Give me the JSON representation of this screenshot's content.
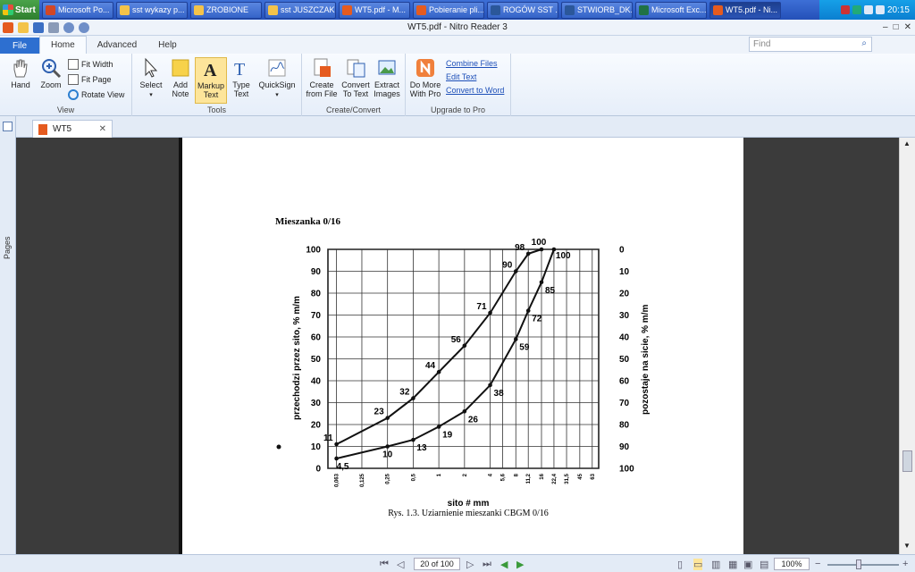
{
  "taskbar": {
    "start_label": "Start",
    "tasks": [
      {
        "label": "Microsoft Po...",
        "color": "#d24726"
      },
      {
        "label": "sst wykazy p...",
        "color": "#f3c34a"
      },
      {
        "label": "ZROBIONE",
        "color": "#f3c34a"
      },
      {
        "label": "sst JUSZCZAK",
        "color": "#f3c34a"
      },
      {
        "label": "WT5.pdf - M...",
        "color": "#e55b1f"
      },
      {
        "label": "Pobieranie pli...",
        "color": "#e55b1f"
      },
      {
        "label": "ROGÓW SST ...",
        "color": "#2b579a"
      },
      {
        "label": "STWIORB_DK...",
        "color": "#2b579a"
      },
      {
        "label": "Microsoft Exc...",
        "color": "#207245"
      },
      {
        "label": "WT5.pdf - Ni...",
        "color": "#e55b1f"
      }
    ],
    "clock": "20:15"
  },
  "window": {
    "title": "WT5.pdf - Nitro Reader 3"
  },
  "ribbon_tabs": [
    "File",
    "Home",
    "Advanced",
    "Help"
  ],
  "search": {
    "placeholder": "Find"
  },
  "ribbon": {
    "view": {
      "label": "View",
      "hand": "Hand",
      "zoom": "Zoom",
      "fit_width": "Fit Width",
      "fit_page": "Fit Page",
      "rotate": "Rotate View"
    },
    "tools": {
      "label": "Tools",
      "select": "Select",
      "add_note_1": "Add",
      "add_note_2": "Note",
      "markup_1": "Markup",
      "markup_2": "Text",
      "type_1": "Type",
      "type_2": "Text",
      "quicksign": "QuickSign"
    },
    "create": {
      "label": "Create/Convert",
      "create_1": "Create",
      "create_2": "from File",
      "convert_1": "Convert",
      "convert_2": "To Text",
      "extract_1": "Extract",
      "extract_2": "Images"
    },
    "upgrade": {
      "label": "Upgrade to Pro",
      "domore_1": "Do More",
      "domore_2": "With Pro",
      "combine": "Combine Files",
      "edit": "Edit Text",
      "convert_word": "Convert to Word"
    }
  },
  "sidepanel": {
    "pages_label": "Pages"
  },
  "doc_tab": {
    "label": "WT5"
  },
  "document": {
    "heading": "Mieszanka 0/16",
    "caption": "Rys. 1.3. Uziarnienie mieszanki CBGM 0/16",
    "ylabel_left": "przechodzi przez sito, % m/m",
    "ylabel_right": "pozostaje na sicie, % m/m",
    "xlabel": "sito # mm"
  },
  "chart_data": {
    "type": "line",
    "x_ticks": [
      "0,063",
      "0,125",
      "0,25",
      "0,5",
      "1",
      "2",
      "4",
      "5,6",
      "8",
      "11,2",
      "16",
      "22,4",
      "31,5",
      "45",
      "63"
    ],
    "y_ticks_left": [
      "0",
      "10",
      "20",
      "30",
      "40",
      "50",
      "60",
      "70",
      "80",
      "90",
      "100"
    ],
    "y_ticks_right": [
      "100",
      "90",
      "80",
      "70",
      "60",
      "50",
      "40",
      "30",
      "20",
      "10",
      "0"
    ],
    "ylim": [
      0,
      100
    ],
    "grid": true,
    "series": [
      {
        "points": [
          [
            0.063,
            11
          ],
          [
            0.25,
            23
          ],
          [
            0.5,
            32
          ],
          [
            1,
            44
          ],
          [
            2,
            56
          ],
          [
            4,
            71
          ],
          [
            8,
            90
          ],
          [
            11.2,
            98
          ],
          [
            16,
            100
          ]
        ],
        "labels": [
          "11",
          "23",
          "32",
          "44",
          "56",
          "71",
          "90",
          "98",
          "100"
        ]
      },
      {
        "points": [
          [
            0.063,
            4.5
          ],
          [
            0.25,
            10
          ],
          [
            0.5,
            13
          ],
          [
            1,
            19
          ],
          [
            2,
            26
          ],
          [
            4,
            38
          ],
          [
            8,
            59
          ],
          [
            11.2,
            72
          ],
          [
            16,
            85
          ],
          [
            22.4,
            100
          ]
        ],
        "labels": [
          "4,5",
          "10",
          "13",
          "19",
          "26",
          "38",
          "59",
          "72",
          "85",
          "100"
        ]
      }
    ]
  },
  "status": {
    "page": "20 of 100",
    "zoom": "100%"
  }
}
